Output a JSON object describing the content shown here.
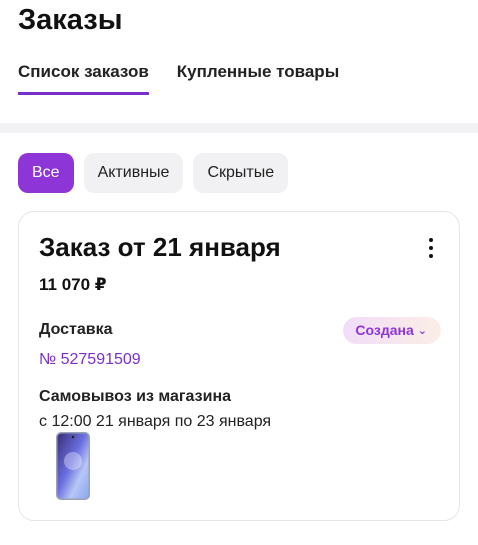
{
  "header": {
    "title": "Заказы",
    "tabs": [
      {
        "label": "Список заказов",
        "active": true
      },
      {
        "label": "Купленные товары",
        "active": false
      }
    ]
  },
  "filters": [
    {
      "label": "Все",
      "active": true
    },
    {
      "label": "Активные",
      "active": false
    },
    {
      "label": "Скрытые",
      "active": false
    }
  ],
  "order": {
    "title": "Заказ от 21 января",
    "price": "11 070 ₽",
    "delivery_label": "Доставка",
    "status": "Создана",
    "number": "№ 527591509",
    "pickup_label": "Самовывоз из магазина",
    "pickup_time": "с 12:00 21 января по 23 января",
    "product_icon": "smartphone-icon"
  },
  "colors": {
    "accent": "#8e35d8",
    "accent_dark": "#7b2fc9",
    "chip_bg": "#f1f1f3"
  }
}
